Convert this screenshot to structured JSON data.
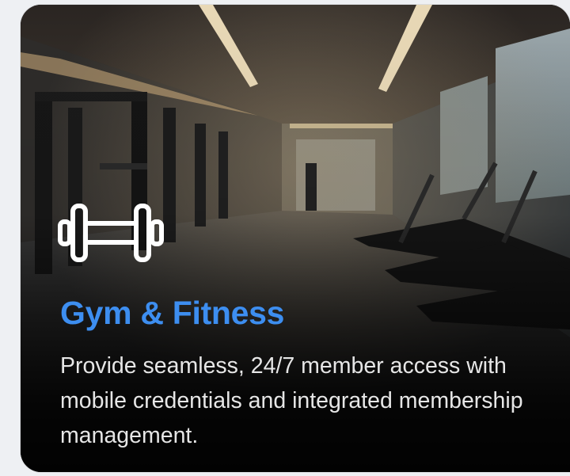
{
  "card": {
    "title": "Gym & Fitness",
    "description": "Provide seamless, 24/7 member access with mobile credentials and integrated membership management.",
    "icon": "dumbbell-icon",
    "accent_color": "#3d8ef0"
  }
}
